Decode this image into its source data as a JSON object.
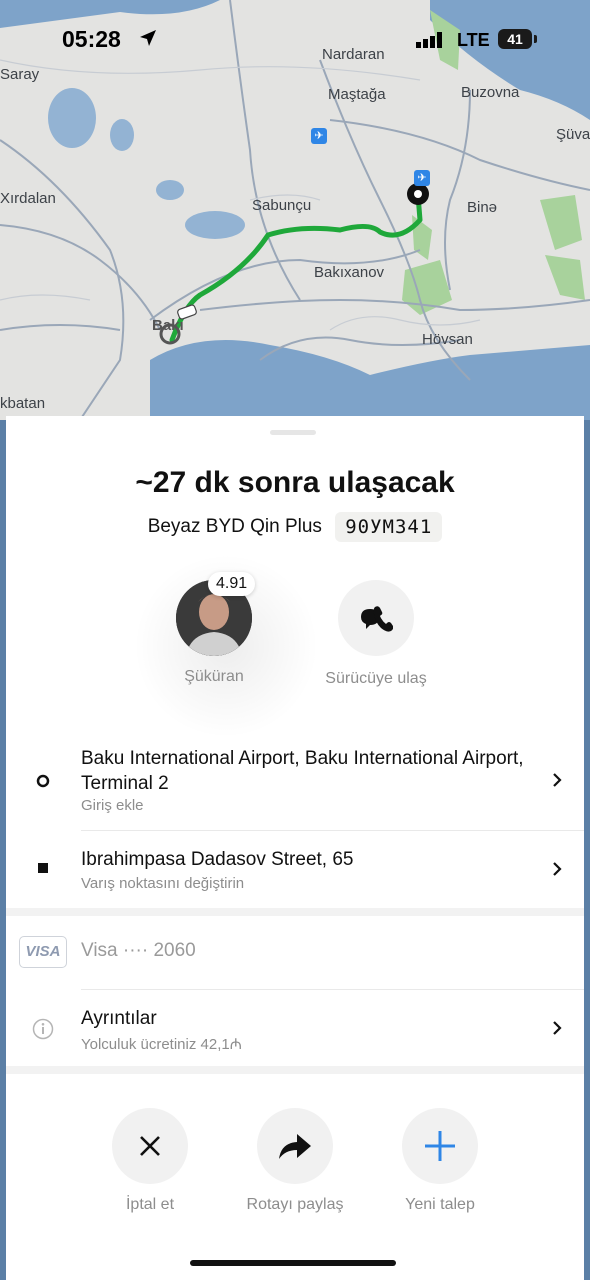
{
  "status_bar": {
    "time": "05:28",
    "network": "LTE",
    "battery": "41"
  },
  "map": {
    "places": [
      "Saray",
      "Nardaran",
      "Maştağa",
      "Buzovna",
      "Şüva",
      "Xırdalan",
      "Sabunçu",
      "Binə",
      "Bakıxanov",
      "Bakı",
      "Hövsan",
      "kbatan"
    ],
    "route_color": "#1fa83a"
  },
  "trip": {
    "eta": "~27 dk sonra ulaşacak",
    "car_model": "Beyaz BYD Qin Plus",
    "plate": "90УМ341"
  },
  "driver": {
    "rating": "4.91",
    "name": "Şüküran",
    "contact_label": "Sürücüye ulaş"
  },
  "route": {
    "pickup_title": "Baku International Airport, Baku International Airport, Terminal 2",
    "pickup_sub": "Giriş ekle",
    "dropoff_title": "Ibrahimpasa Dadasov Street, 65",
    "dropoff_sub": "Varış noktasını değiştirin"
  },
  "payment": {
    "brand": "VISA",
    "label": "Visa ···· 2060"
  },
  "details": {
    "title": "Ayrıntılar",
    "sub": "Yolculuk ücretiniz 42,1₼"
  },
  "actions": {
    "cancel": "İptal et",
    "share": "Rotayı paylaş",
    "new_request": "Yeni talep"
  },
  "colors": {
    "accent_blue": "#2f86e6",
    "map_land": "#e4e4e2",
    "map_water": "#7ea3c9"
  }
}
